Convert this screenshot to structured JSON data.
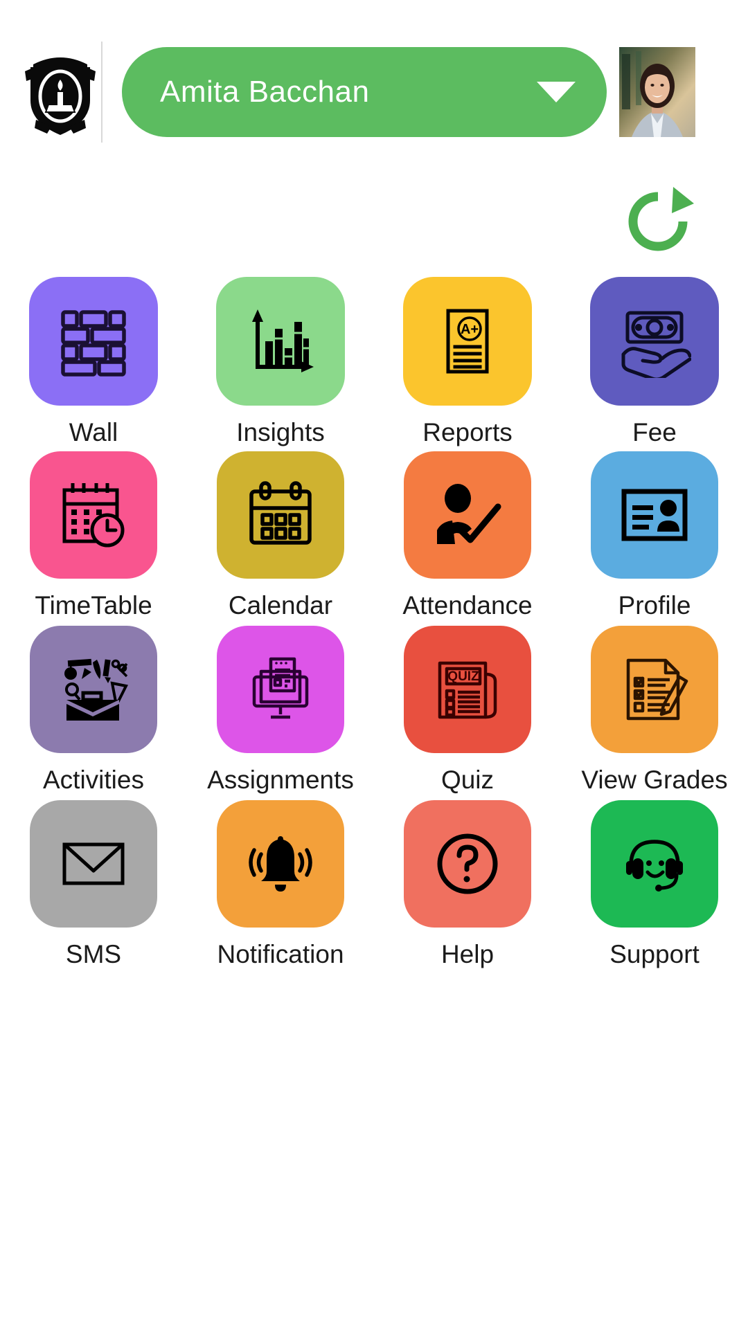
{
  "header": {
    "logo_icon": "school-crest-logo",
    "user_name": "Amita Bacchan",
    "dropdown_icon": "chevron-down-icon",
    "avatar_icon": "user-photo",
    "pill_color": "#5CBC60"
  },
  "toolbar": {
    "refresh_icon": "refresh-icon",
    "refresh_color": "#4CAF50"
  },
  "grid": {
    "items": [
      {
        "label": "Wall",
        "icon": "brick-wall-icon",
        "tile_color": "#8B6FF5",
        "icon_color": "#1a1033"
      },
      {
        "label": "Insights",
        "icon": "bar-chart-icon",
        "tile_color": "#8BD98B",
        "icon_color": "#000000"
      },
      {
        "label": "Reports",
        "icon": "report-card-icon",
        "tile_color": "#FBC52D",
        "icon_color": "#000000"
      },
      {
        "label": "Fee",
        "icon": "money-in-hand-icon",
        "tile_color": "#5F5BBF",
        "icon_color": "#0d0d26"
      },
      {
        "label": "TimeTable",
        "icon": "calendar-clock-icon",
        "tile_color": "#F9558F",
        "icon_color": "#000000"
      },
      {
        "label": "Calendar",
        "icon": "calendar-icon",
        "tile_color": "#CFB230",
        "icon_color": "#000000"
      },
      {
        "label": "Attendance",
        "icon": "person-check-icon",
        "tile_color": "#F47B41",
        "icon_color": "#000000"
      },
      {
        "label": "Profile",
        "icon": "id-card-icon",
        "tile_color": "#5BACE0",
        "icon_color": "#000000"
      },
      {
        "label": "Activities",
        "icon": "briefcase-supplies-icon",
        "tile_color": "#8C7BAE",
        "icon_color": "#000000"
      },
      {
        "label": "Assignments",
        "icon": "monitor-document-icon",
        "tile_color": "#DD55E8",
        "icon_color": "#2a0033"
      },
      {
        "label": "Quiz",
        "icon": "quiz-paper-icon",
        "tile_color": "#E8503F",
        "icon_color": "#3a0000"
      },
      {
        "label": "View Grades",
        "icon": "checklist-pencil-icon",
        "tile_color": "#F3A03A",
        "icon_color": "#2b1400"
      },
      {
        "label": "SMS",
        "icon": "envelope-icon",
        "tile_color": "#A8A8A8",
        "icon_color": "#000000"
      },
      {
        "label": "Notification",
        "icon": "bell-ringing-icon",
        "tile_color": "#F3A03A",
        "icon_color": "#000000"
      },
      {
        "label": "Help",
        "icon": "question-circle-icon",
        "tile_color": "#F0705F",
        "icon_color": "#000000"
      },
      {
        "label": "Support",
        "icon": "headset-smiley-icon",
        "tile_color": "#1DB954",
        "icon_color": "#000000"
      }
    ]
  }
}
